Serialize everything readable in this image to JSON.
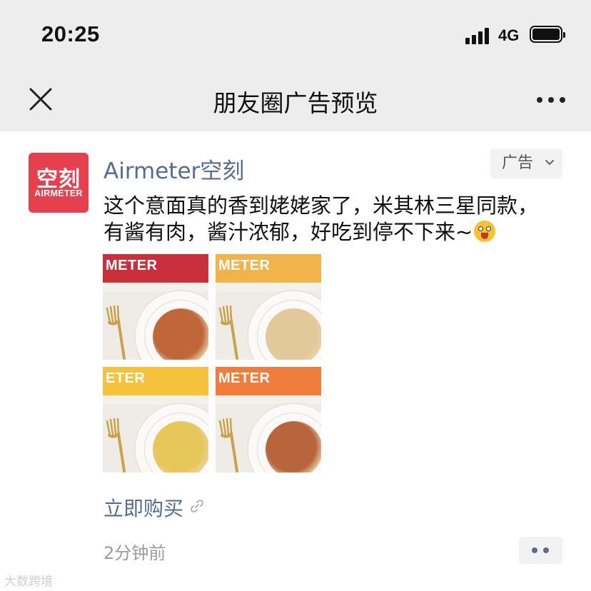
{
  "status_bar": {
    "time": "20:25",
    "network": "4G"
  },
  "nav": {
    "title": "朋友圈广告预览"
  },
  "post": {
    "avatar": {
      "cn": "空刻",
      "en": "AIRMETER"
    },
    "author": "Airmeter空刻",
    "ad_tag": "广告",
    "text_line1": "这个意面真的香到姥姥家了，米其林三星同款，",
    "text_line2": "有酱有肉，酱汁浓郁，好吃到停不下来~",
    "photos": [
      {
        "box_text": "METER",
        "box_color": "#c9303c",
        "pasta_color": "#c0673a"
      },
      {
        "box_text": "METER",
        "box_color": "#f0b44a",
        "pasta_color": "#e2c89a"
      },
      {
        "box_text": "ETER",
        "box_color": "#f5c23c",
        "pasta_color": "#e8c75a"
      },
      {
        "box_text": "METER",
        "box_color": "#ef7d3c",
        "pasta_color": "#b8643c"
      }
    ],
    "action_link": "立即购买",
    "time_ago": "2分钟前"
  },
  "watermark": "大数跨境",
  "colors": {
    "link": "#576b95",
    "topbar_bg": "#ededed",
    "brand_red": "#e6404f"
  }
}
